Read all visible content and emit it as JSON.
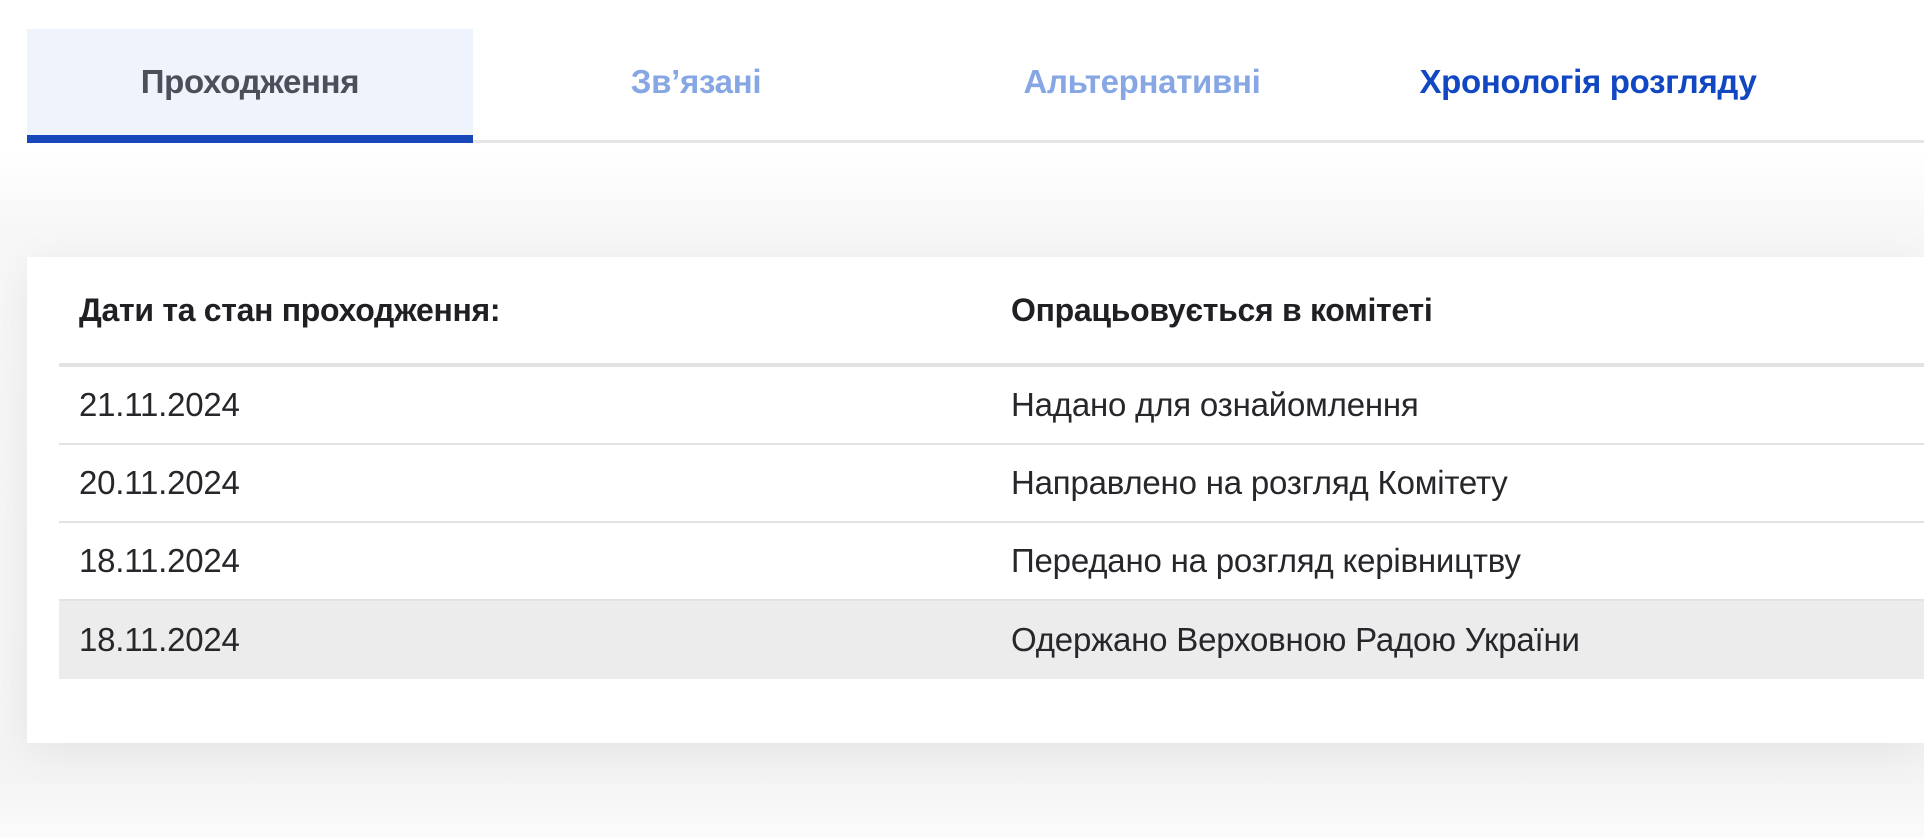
{
  "tabs": [
    {
      "label": "Проходження",
      "state": "active"
    },
    {
      "label": "Зв’язані",
      "state": "muted"
    },
    {
      "label": "Альтернативні",
      "state": "muted"
    },
    {
      "label": "Хронологія розгляду",
      "state": "strong"
    }
  ],
  "table": {
    "headers": {
      "dates": "Дати та стан проходження:",
      "status": "Опрацьовується в комітеті"
    },
    "rows": [
      {
        "date": "21.11.2024",
        "status": "Надано для ознайомлення"
      },
      {
        "date": "20.11.2024",
        "status": "Направлено на розгляд Комітету"
      },
      {
        "date": "18.11.2024",
        "status": "Передано на розгляд керівництву"
      },
      {
        "date": "18.11.2024",
        "status": "Одержано Верховною Радою України"
      }
    ]
  },
  "colors": {
    "tab_active_bg": "#eef3fc",
    "tab_active_underline": "#1747b8",
    "tab_muted_text": "#86a7e3",
    "tab_strong_text": "#1147c2",
    "row_highlight_bg": "#ececec"
  }
}
